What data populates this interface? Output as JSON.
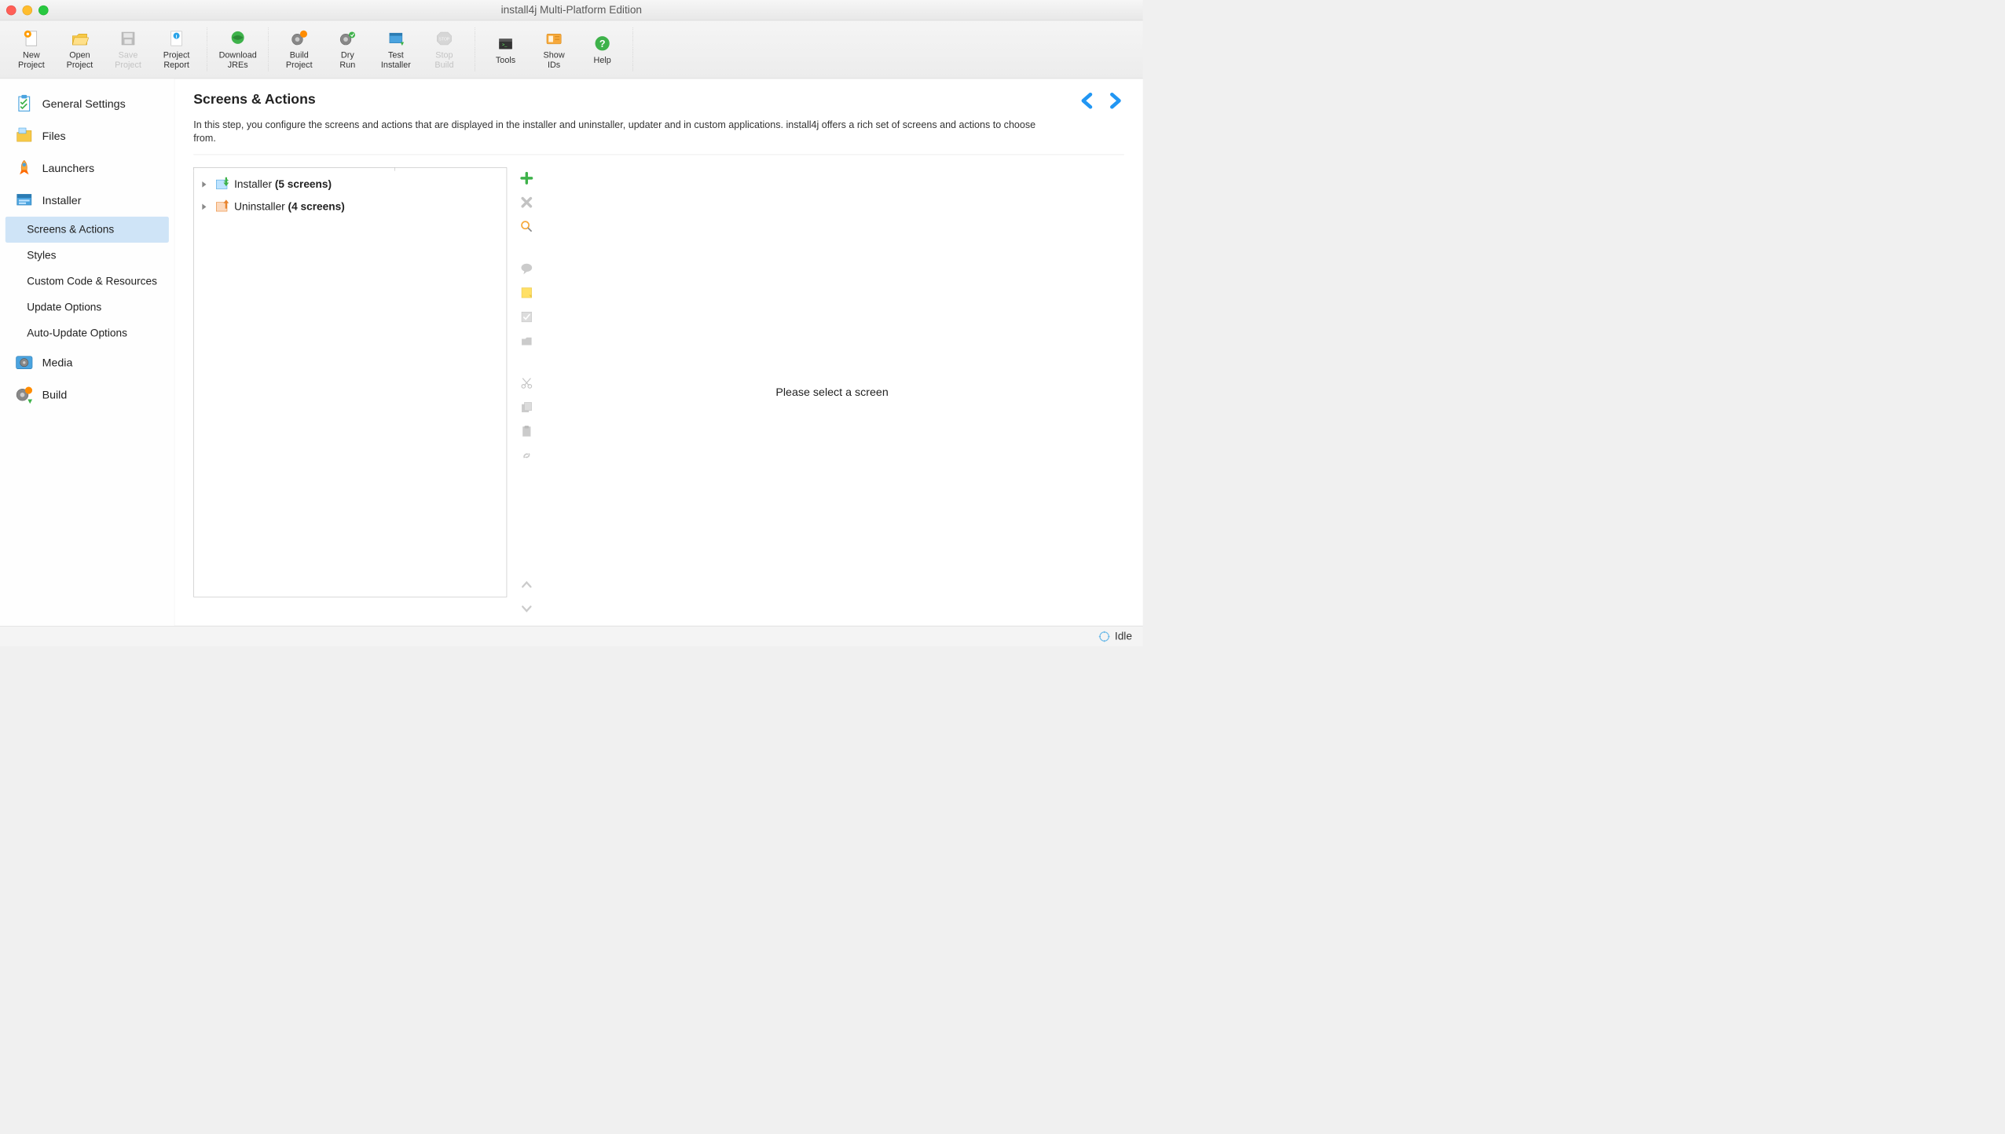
{
  "window": {
    "title": "install4j Multi-Platform Edition"
  },
  "toolbar": {
    "new_project": "New\nProject",
    "open_project": "Open\nProject",
    "save_project": "Save\nProject",
    "project_report": "Project\nReport",
    "download_jres": "Download\nJREs",
    "build_project": "Build\nProject",
    "dry_run": "Dry\nRun",
    "test_installer": "Test\nInstaller",
    "stop_build": "Stop\nBuild",
    "tools": "Tools",
    "show_ids": "Show\nIDs",
    "help": "Help"
  },
  "sidebar": {
    "general_settings": "General Settings",
    "files": "Files",
    "launchers": "Launchers",
    "installer": "Installer",
    "installer_subs": {
      "screens_actions": "Screens & Actions",
      "styles": "Styles",
      "custom_code": "Custom Code & Resources",
      "update_options": "Update Options",
      "auto_update": "Auto-Update Options"
    },
    "media": "Media",
    "build": "Build"
  },
  "content": {
    "title": "Screens & Actions",
    "description": "In this step, you configure the screens and actions that are displayed in the installer and uninstaller, updater and in custom applications. install4j offers a rich set of screens and actions to choose from.",
    "tree": {
      "installer": {
        "label": "Installer",
        "count": "(5 screens)"
      },
      "uninstaller": {
        "label": "Uninstaller",
        "count": "(4 screens)"
      }
    },
    "detail_placeholder": "Please select a screen"
  },
  "status": {
    "text": "Idle"
  }
}
